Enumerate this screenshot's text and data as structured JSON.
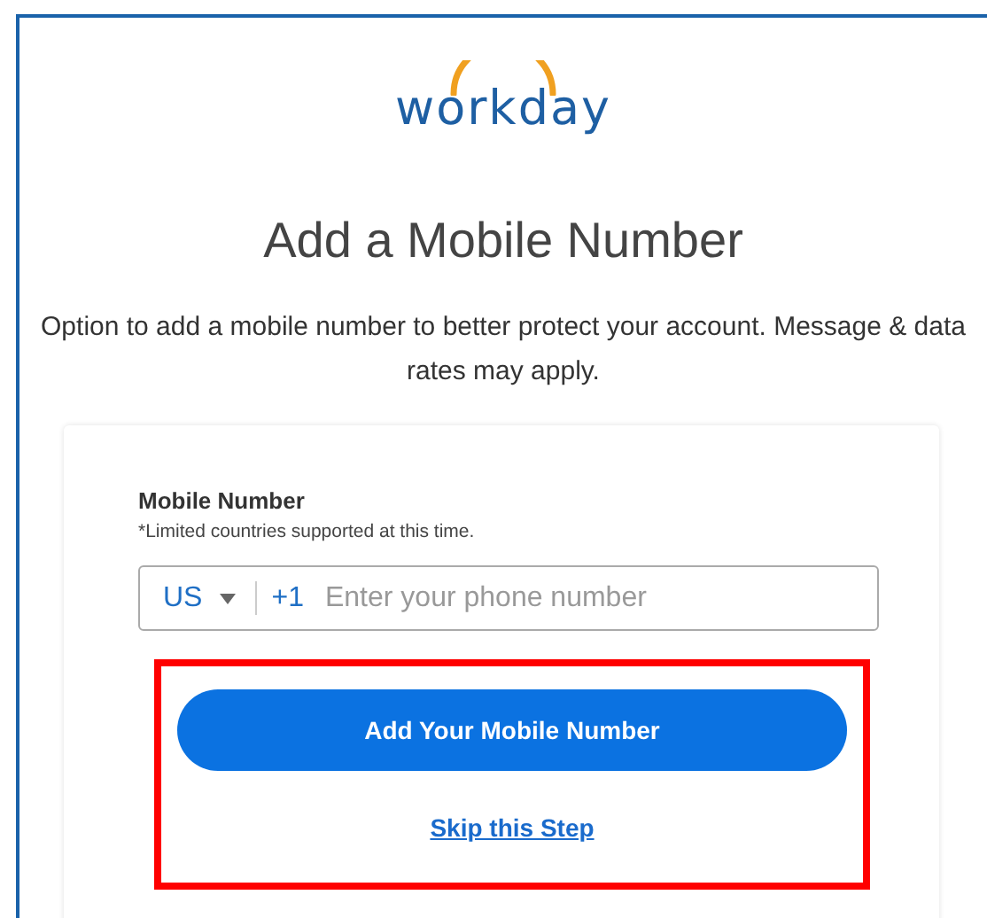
{
  "logo": {
    "text": "workday"
  },
  "heading": "Add a Mobile Number",
  "description": "Option to add a mobile number to better protect your account. Message & data rates may apply.",
  "form": {
    "label": "Mobile Number",
    "hint": "*Limited countries supported at this time.",
    "phone_field": {
      "country": "US",
      "country_code": "+1",
      "placeholder": "Enter your phone number"
    }
  },
  "primary_button": "Add Your Mobile Number",
  "skip_link": "Skip this Step"
}
